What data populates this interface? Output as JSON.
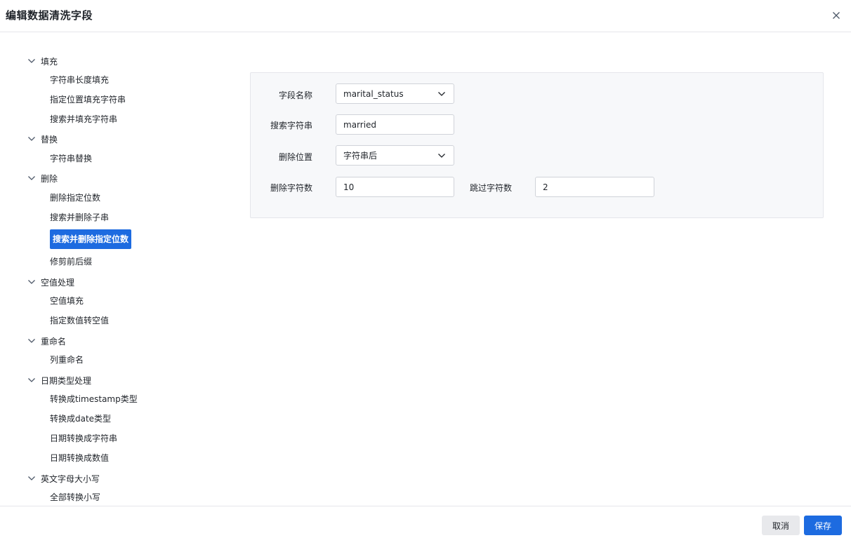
{
  "dialog": {
    "title": "编辑数据清洗字段"
  },
  "tree": {
    "groups": [
      {
        "label": "填充",
        "items": [
          "字符串长度填充",
          "指定位置填充字符串",
          "搜索并填充字符串"
        ]
      },
      {
        "label": "替换",
        "items": [
          "字符串替换"
        ]
      },
      {
        "label": "删除",
        "items": [
          "删除指定位数",
          "搜索并删除子串",
          "搜索并删除指定位数",
          "修剪前后缀"
        ]
      },
      {
        "label": "空值处理",
        "items": [
          "空值填充",
          "指定数值转空值"
        ]
      },
      {
        "label": "重命名",
        "items": [
          "列重命名"
        ]
      },
      {
        "label": "日期类型处理",
        "items": [
          "转换成timestamp类型",
          "转换成date类型",
          "日期转换成字符串",
          "日期转换成数值"
        ]
      },
      {
        "label": "英文字母大小写",
        "items": [
          "全部转换小写"
        ]
      }
    ],
    "selected_item": "搜索并删除指定位数"
  },
  "form": {
    "field_name": {
      "label": "字段名称",
      "value": "marital_status"
    },
    "search_string": {
      "label": "搜索字符串",
      "value": "married"
    },
    "delete_position": {
      "label": "删除位置",
      "value": "字符串后"
    },
    "delete_chars": {
      "label": "删除字符数",
      "value": "10"
    },
    "skip_chars": {
      "label": "跳过字符数",
      "value": "2"
    }
  },
  "footer": {
    "cancel_label": "取消",
    "save_label": "保存"
  },
  "colors": {
    "accent": "#1d6be0",
    "panel_bg": "#f7f8fa",
    "border": "#e5e6eb"
  }
}
